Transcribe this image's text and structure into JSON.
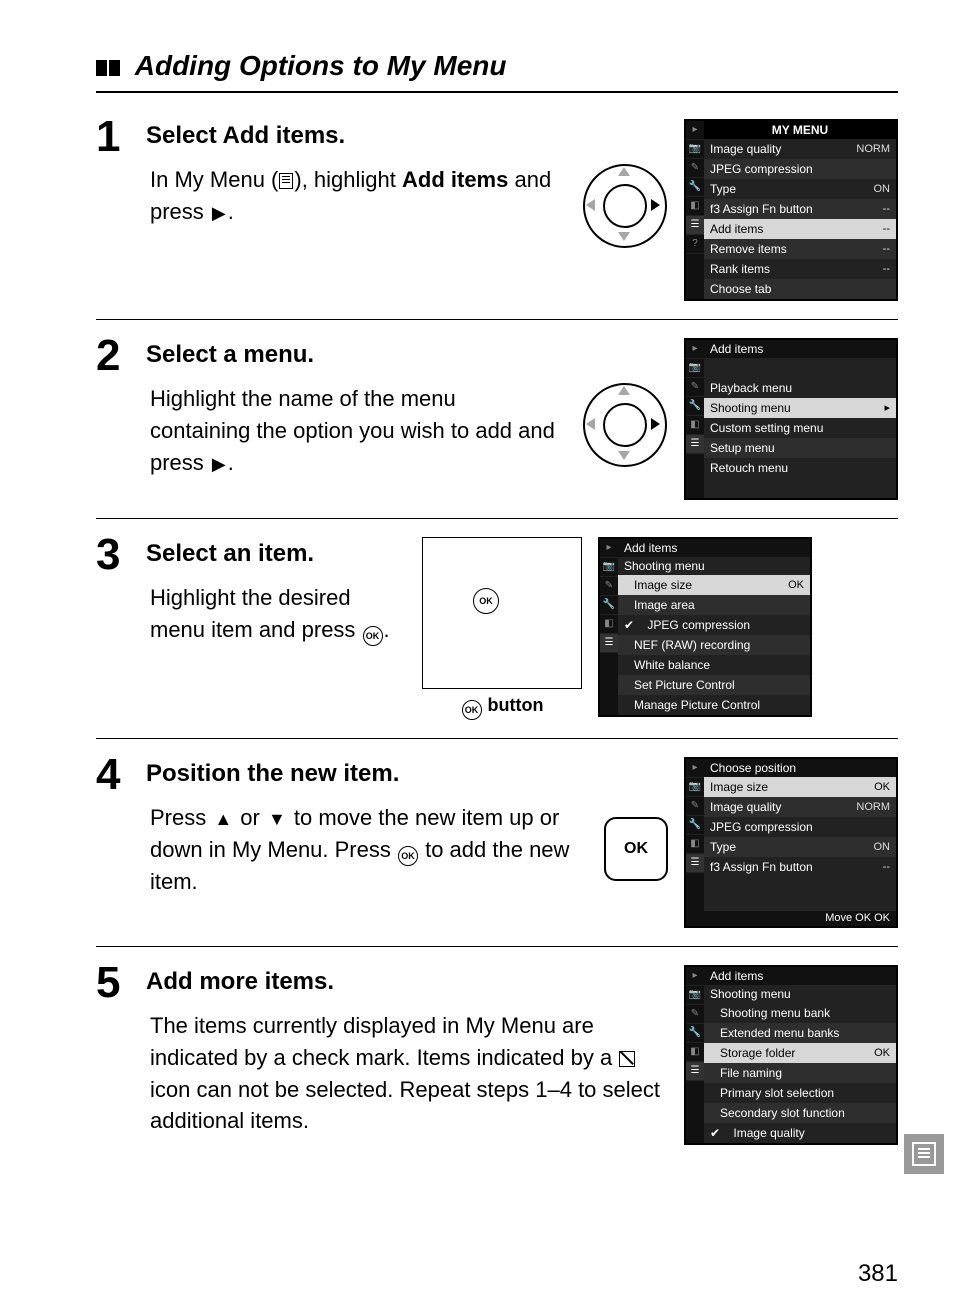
{
  "page_number": "381",
  "section_title": "Adding Options to My Menu",
  "ok_button_caption": "button",
  "ok_text": "OK",
  "symbols": {
    "right": "▶",
    "up": "▲",
    "down": "▼"
  },
  "steps": [
    {
      "num": "1",
      "title": "Select Add items.",
      "desc_parts": [
        "In My Menu (",
        "), highlight ",
        "Add items",
        " and press ",
        "."
      ]
    },
    {
      "num": "2",
      "title": "Select a menu.",
      "desc_parts": [
        "Highlight the name of the menu containing the option you wish to add and press ",
        "."
      ]
    },
    {
      "num": "3",
      "title": "Select an item.",
      "desc_parts": [
        "Highlight the desired menu item and press ",
        "."
      ]
    },
    {
      "num": "4",
      "title": "Position the new item.",
      "desc_parts": [
        "Press ",
        " or ",
        " to move the new item up or down in My Menu.  Press ",
        " to add the new item."
      ]
    },
    {
      "num": "5",
      "title": "Add more items.",
      "desc_parts": [
        "The items currently displayed in My Menu are indicated by a check mark.  Items indicated by a ",
        " icon can not be selected.  Repeat steps 1–4 to select additional items."
      ]
    }
  ],
  "lcd1": {
    "title": "MY MENU",
    "rows": [
      {
        "label": "Image quality",
        "val": "NORM"
      },
      {
        "label": "JPEG compression",
        "val": ""
      },
      {
        "label": "Type",
        "val": "ON"
      },
      {
        "label": "f3 Assign Fn button",
        "val": "--"
      },
      {
        "label": "Add items",
        "val": "--",
        "sel": true
      },
      {
        "label": "Remove items",
        "val": "--"
      },
      {
        "label": "Rank items",
        "val": "--"
      },
      {
        "label": "Choose tab",
        "val": ""
      }
    ]
  },
  "lcd2": {
    "hdr": "Add items",
    "rows": [
      {
        "label": "Playback menu"
      },
      {
        "label": "Shooting menu",
        "sel": true,
        "arrow": true
      },
      {
        "label": "Custom setting menu"
      },
      {
        "label": "Setup menu"
      },
      {
        "label": "Retouch menu"
      }
    ]
  },
  "lcd3": {
    "hdr": "Add items",
    "sub": "Shooting menu",
    "rows": [
      {
        "label": "Image size",
        "sel": true,
        "ok": true
      },
      {
        "label": "Image area"
      },
      {
        "label": "JPEG compression",
        "check": true
      },
      {
        "label": "NEF (RAW) recording"
      },
      {
        "label": "White balance"
      },
      {
        "label": "Set Picture Control"
      },
      {
        "label": "Manage Picture Control"
      }
    ]
  },
  "lcd4": {
    "hdr": "Choose position",
    "rows": [
      {
        "label": "Image size",
        "sel": true,
        "ok": true
      },
      {
        "label": "Image quality",
        "val": "NORM"
      },
      {
        "label": "JPEG compression",
        "val": ""
      },
      {
        "label": "Type",
        "val": "ON"
      },
      {
        "label": "f3 Assign Fn button",
        "val": "--"
      }
    ],
    "foot": "Move   OK OK"
  },
  "lcd5": {
    "hdr": "Add items",
    "sub": "Shooting menu",
    "rows": [
      {
        "label": "Shooting menu bank"
      },
      {
        "label": "Extended menu banks"
      },
      {
        "label": "Storage folder",
        "sel": true,
        "ok": true
      },
      {
        "label": "File naming"
      },
      {
        "label": "Primary slot selection"
      },
      {
        "label": "Secondary slot function"
      },
      {
        "label": "Image quality",
        "check": true
      }
    ]
  }
}
